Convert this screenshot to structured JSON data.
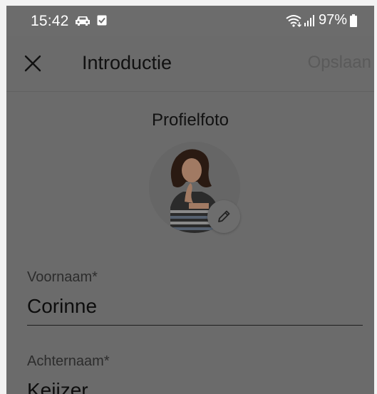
{
  "status_bar": {
    "time": "15:42",
    "battery": "97%",
    "icons": [
      "car-icon",
      "checkbox-notification-icon",
      "wifi-icon",
      "signal-icon",
      "battery-icon"
    ]
  },
  "app_bar": {
    "title": "Introductie",
    "save_label": "Opslaan",
    "close_icon": "close-icon"
  },
  "profile": {
    "heading": "Profielfoto",
    "edit_icon": "pencil-icon"
  },
  "fields": {
    "first_name": {
      "label": "Voornaam*",
      "value": "Corinne"
    },
    "last_name": {
      "label": "Achternaam*",
      "value": "Keijzer"
    }
  },
  "colors": {
    "overlay": "#6b6b6b",
    "text": "#111111",
    "status_text": "#ffffff"
  }
}
